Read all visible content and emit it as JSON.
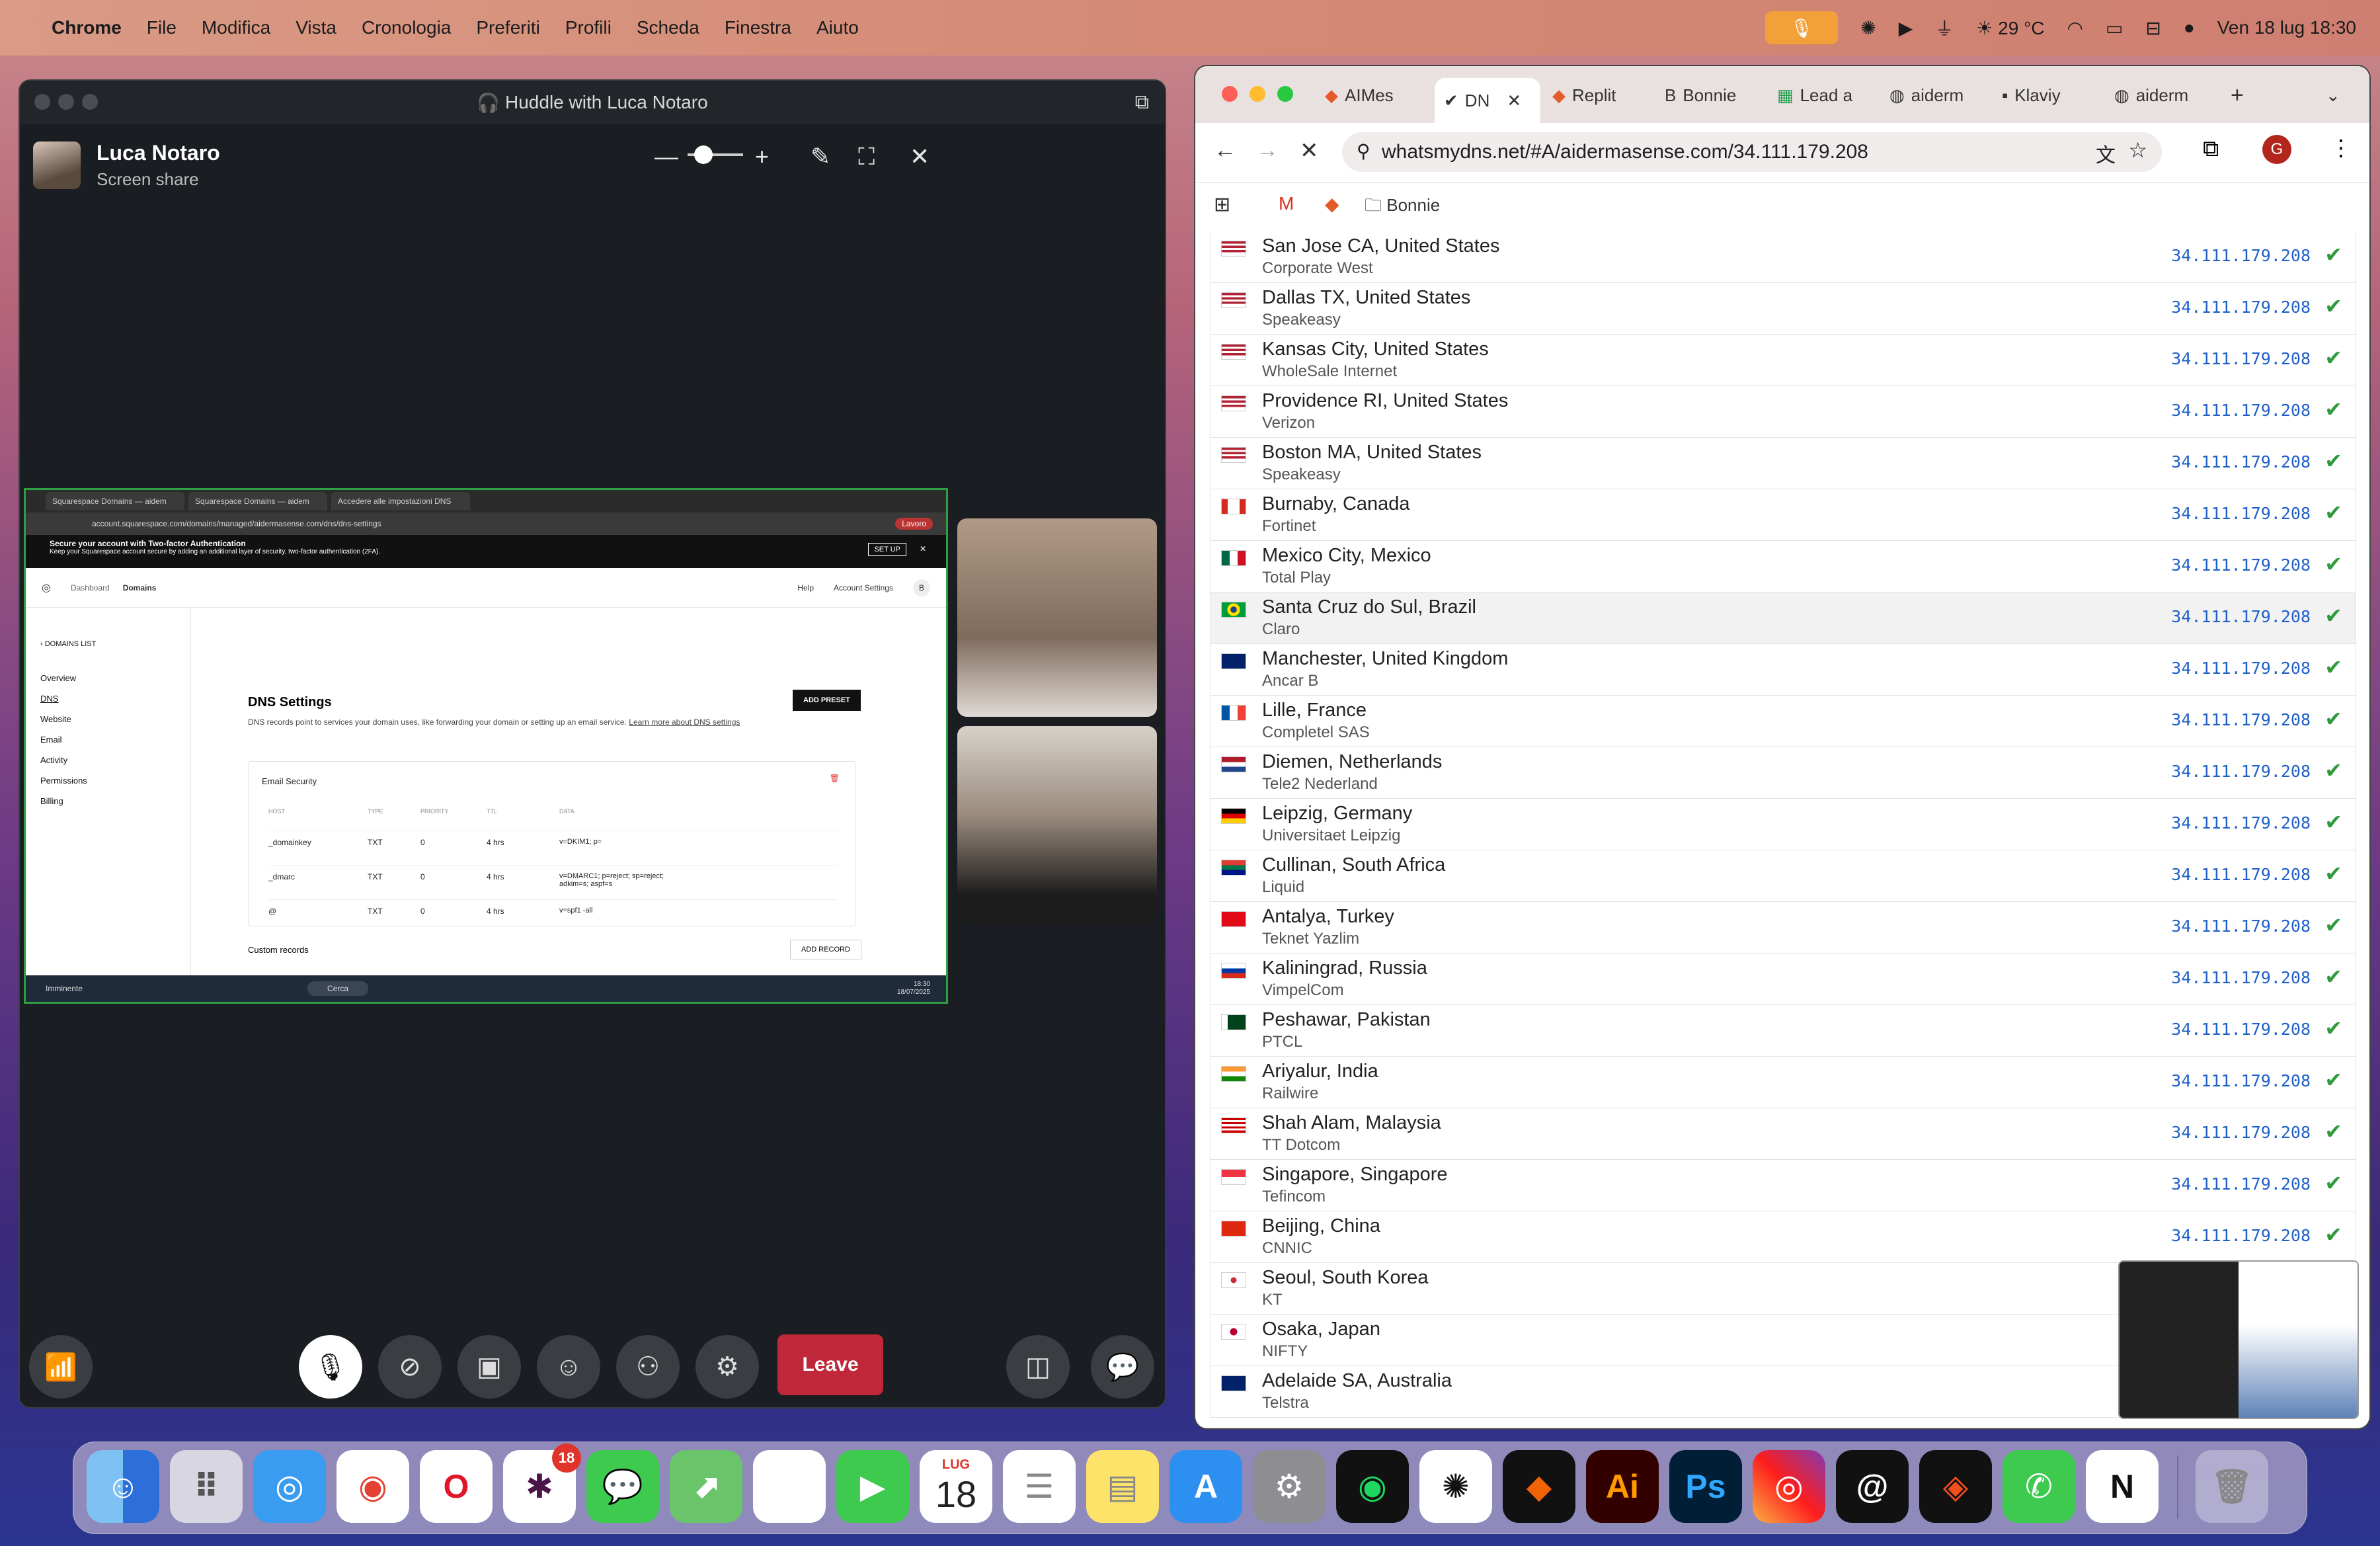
{
  "menubar": {
    "apple_icon": "apple-icon",
    "app": "Chrome",
    "items": [
      "File",
      "Modifica",
      "Vista",
      "Cronologia",
      "Preferiti",
      "Profili",
      "Scheda",
      "Finestra",
      "Aiuto"
    ],
    "temperature": "29 °C",
    "datetime": "Ven 18 lug  18:30"
  },
  "huddle": {
    "title": "Huddle with Luca Notaro",
    "presenter_name": "Luca Notaro",
    "presenter_status": "Screen share",
    "leave_label": "Leave",
    "shared_screen": {
      "tabs": [
        "Squarespace Domains — aidem",
        "Squarespace Domains — aidem",
        "Accedere alle impostazioni DNS"
      ],
      "address": "account.squarespace.com/domains/managed/aidermasense.com/dns/dns-settings",
      "profile": "Lavoro",
      "banner_title": "Secure your account with Two-factor Authentication",
      "banner_text": "Keep your Squarespace account secure by adding an additional layer of security, two-factor authentication (2FA).",
      "banner_button": "SET UP",
      "nav": [
        "Dashboard",
        "Domains"
      ],
      "nav_right": [
        "Help",
        "Account Settings"
      ],
      "back_link": "DOMAINS LIST",
      "side": [
        "Overview",
        "DNS",
        "Website",
        "Email",
        "Activity",
        "Permissions",
        "Billing"
      ],
      "heading": "DNS Settings",
      "description": "DNS records point to services your domain uses, like forwarding your domain or setting up an email service.",
      "learn_more": "Learn more about DNS settings",
      "add_preset": "ADD PRESET",
      "section": "Email Security",
      "columns": [
        "HOST",
        "TYPE",
        "PRIORITY",
        "TTL",
        "DATA"
      ],
      "records": [
        [
          "_domainkey",
          "TXT",
          "0",
          "4 hrs",
          "v=DKIM1; p="
        ],
        [
          "_dmarc",
          "TXT",
          "0",
          "4 hrs",
          "v=DMARC1; p=reject; sp=reject; adkim=s; aspf=s"
        ],
        [
          "@",
          "TXT",
          "0",
          "4 hrs",
          "v=spf1 -all"
        ]
      ],
      "custom_records": "Custom records",
      "add_record": "ADD RECORD",
      "taskbar_weather": "Imminente",
      "taskbar_search": "Cerca",
      "taskbar_time": "18:30",
      "taskbar_date": "18/07/2025"
    }
  },
  "chrome": {
    "tabs": [
      "AIMes",
      "DN",
      "Replit",
      "Bonnie",
      "Lead a",
      "aiderm",
      "Klaviy",
      "aiderm"
    ],
    "url": "whatsmydns.net/#A/aidermasense.com/34.111.179.208",
    "profile_initial": "G",
    "bookmark_folder": "Bonnie",
    "rows": [
      {
        "city": "San Jose CA, United States",
        "isp": "Corporate West",
        "flag": "us"
      },
      {
        "city": "Dallas TX, United States",
        "isp": "Speakeasy",
        "flag": "us"
      },
      {
        "city": "Kansas City, United States",
        "isp": "WholeSale Internet",
        "flag": "us"
      },
      {
        "city": "Providence RI, United States",
        "isp": "Verizon",
        "flag": "us"
      },
      {
        "city": "Boston MA, United States",
        "isp": "Speakeasy",
        "flag": "us"
      },
      {
        "city": "Burnaby, Canada",
        "isp": "Fortinet",
        "flag": "ca"
      },
      {
        "city": "Mexico City, Mexico",
        "isp": "Total Play",
        "flag": "mx"
      },
      {
        "city": "Santa Cruz do Sul, Brazil",
        "isp": "Claro",
        "flag": "br"
      },
      {
        "city": "Manchester, United Kingdom",
        "isp": "Ancar B",
        "flag": "gb"
      },
      {
        "city": "Lille, France",
        "isp": "Completel SAS",
        "flag": "fr"
      },
      {
        "city": "Diemen, Netherlands",
        "isp": "Tele2 Nederland",
        "flag": "nl"
      },
      {
        "city": "Leipzig, Germany",
        "isp": "Universitaet Leipzig",
        "flag": "de"
      },
      {
        "city": "Cullinan, South Africa",
        "isp": "Liquid",
        "flag": "za"
      },
      {
        "city": "Antalya, Turkey",
        "isp": "Teknet Yazlim",
        "flag": "tr"
      },
      {
        "city": "Kaliningrad, Russia",
        "isp": "VimpelCom",
        "flag": "ru"
      },
      {
        "city": "Peshawar, Pakistan",
        "isp": "PTCL",
        "flag": "pk"
      },
      {
        "city": "Ariyalur, India",
        "isp": "Railwire",
        "flag": "in"
      },
      {
        "city": "Shah Alam, Malaysia",
        "isp": "TT Dotcom",
        "flag": "my"
      },
      {
        "city": "Singapore, Singapore",
        "isp": "Tefincom",
        "flag": "sg"
      },
      {
        "city": "Beijing, China",
        "isp": "CNNIC",
        "flag": "cn"
      },
      {
        "city": "Seoul, South Korea",
        "isp": "KT",
        "flag": "kr"
      },
      {
        "city": "Osaka, Japan",
        "isp": "NIFTY",
        "flag": "jp"
      },
      {
        "city": "Adelaide SA, Australia",
        "isp": "Telstra",
        "flag": "au"
      }
    ],
    "ip": "34.111.179.208",
    "ip_rows_shown": 20
  },
  "dock": {
    "calendar_month": "LUG",
    "calendar_day": "18",
    "slack_badge": "18"
  }
}
